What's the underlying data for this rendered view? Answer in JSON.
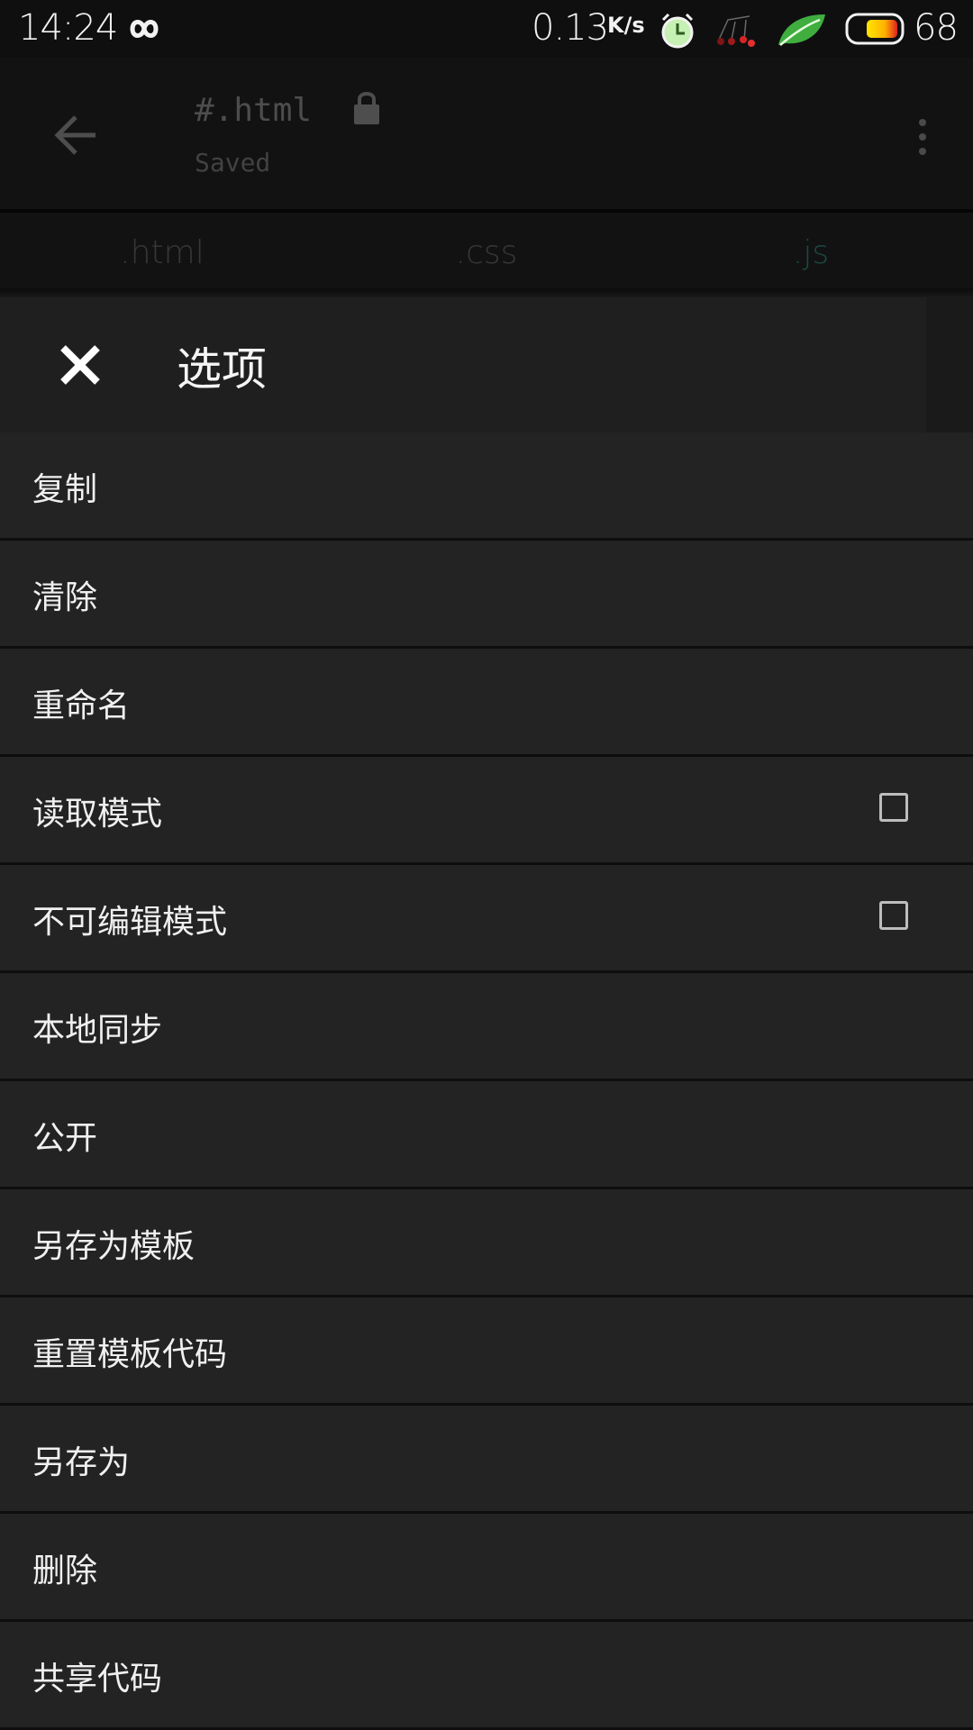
{
  "status_bar": {
    "time": "14:24",
    "net_speed": "0.13",
    "net_speed_unit": "K/s",
    "battery_percent": "68",
    "icons": [
      "infinity-icon",
      "alarm-clock-icon",
      "notification-dots-icon",
      "leaf-icon",
      "battery-icon"
    ]
  },
  "app_bar": {
    "title": "#.html",
    "subtitle": "Saved",
    "icons": [
      "back-arrow-icon",
      "lock-icon",
      "more-vert-icon"
    ]
  },
  "tabs": [
    {
      "label": ".html",
      "active": false
    },
    {
      "label": ".css",
      "active": false
    },
    {
      "label": ".js",
      "active": true
    }
  ],
  "options_panel": {
    "title": "选项",
    "close_icon": "close-icon",
    "items": [
      {
        "label": "复制",
        "checkbox": false
      },
      {
        "label": "清除",
        "checkbox": false
      },
      {
        "label": "重命名",
        "checkbox": false
      },
      {
        "label": "读取模式",
        "checkbox": true,
        "checked": false
      },
      {
        "label": "不可编辑模式",
        "checkbox": true,
        "checked": false
      },
      {
        "label": "本地同步",
        "checkbox": false
      },
      {
        "label": "公开",
        "checkbox": false
      },
      {
        "label": "另存为模板",
        "checkbox": false
      },
      {
        "label": "重置模板代码",
        "checkbox": false
      },
      {
        "label": "另存为",
        "checkbox": false
      },
      {
        "label": "删除",
        "checkbox": false
      },
      {
        "label": "共享代码",
        "checkbox": false
      }
    ]
  },
  "colors": {
    "background": "#1c1c1d",
    "menu_item_bg": "#232324",
    "active_tab": "#1a4a40",
    "text": "#f0f0f0"
  }
}
